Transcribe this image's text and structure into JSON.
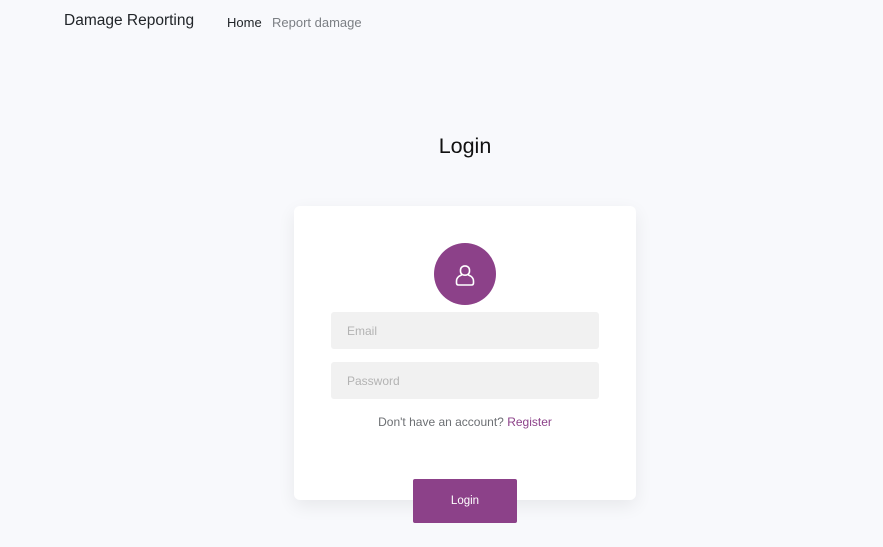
{
  "navbar": {
    "brand": "Damage Reporting",
    "links": [
      {
        "label": "Home"
      },
      {
        "label": "Report damage"
      }
    ]
  },
  "page": {
    "title": "Login"
  },
  "form": {
    "avatar_icon": "user-icon",
    "email": {
      "value": "",
      "placeholder": "Email"
    },
    "password": {
      "value": "",
      "placeholder": "Password"
    },
    "register_prompt": "Don't have an account?",
    "register_link": "Register",
    "submit_label": "Login"
  },
  "colors": {
    "accent": "#8c4189",
    "background": "#f8f9fc",
    "card": "#ffffff",
    "input_bg": "#f1f1f1"
  }
}
